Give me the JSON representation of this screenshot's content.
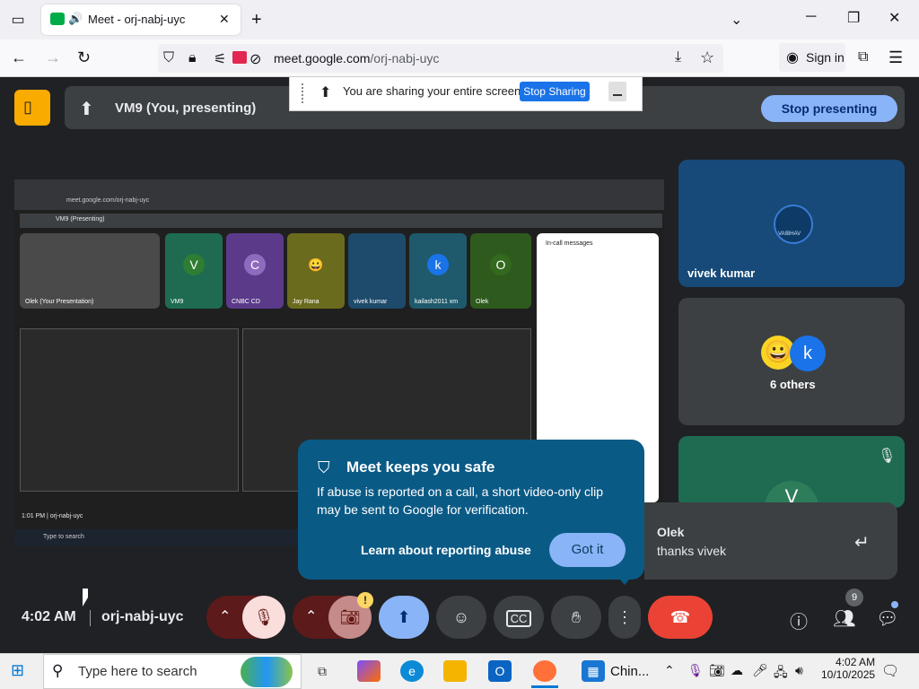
{
  "browser": {
    "tab_title": "Meet - orj-nabj-uyc",
    "url_host": "meet.google.com",
    "url_path": "/orj-nabj-uyc",
    "sign_in": "Sign in"
  },
  "share_banner": {
    "text": "You are sharing your entire screen.",
    "stop_label": "Stop Sharing"
  },
  "header": {
    "presenting_title": "VM9 (You, presenting)",
    "stop_presenting_label": "Stop presenting"
  },
  "shared_screen": {
    "url": "meet.google.com/orj-nabj-uyc",
    "meet_header": "VM9 (Presenting)",
    "tiles": [
      {
        "name": "Olek (Your Presentation)",
        "initial": ""
      },
      {
        "name": "VM9",
        "initial": "V"
      },
      {
        "name": "CNBC CD",
        "initial": "C"
      },
      {
        "name": "Jay Rana",
        "initial": "😀"
      },
      {
        "name": "vivek kumar",
        "initial": ""
      },
      {
        "name": "kailash2011 xm",
        "initial": "k"
      },
      {
        "name": "Olek",
        "initial": "O"
      }
    ],
    "chat_title": "In-call messages",
    "time_code": "1:01 PM | orj-nabj-uyc",
    "taskbar_search": "Type to search"
  },
  "participants": [
    {
      "name": "vivek kumar",
      "badge": "VAIBHAV"
    },
    {
      "name": "6 others",
      "initial": "k"
    },
    {
      "name": "",
      "initial": "V"
    }
  ],
  "safety_popup": {
    "title": "Meet keeps you safe",
    "body": "If abuse is reported on a call, a short video-only clip may be sent to Google for verification.",
    "learn_link": "Learn about reporting abuse",
    "got_it": "Got it"
  },
  "notification": {
    "sender": "Olek",
    "message": "thanks vivek"
  },
  "controls": {
    "time": "4:02 AM",
    "meeting_code": "orj-nabj-uyc",
    "people_count": "9"
  },
  "taskbar": {
    "search_placeholder": "Type here to search",
    "app_label": "Chin...",
    "time": "4:02 AM",
    "date": "10/10/2025"
  },
  "colors": {
    "meet_bg": "#202124",
    "accent_blue": "#8ab4f8",
    "end_call_red": "#ea4335",
    "popup_blue": "#0a5a86"
  }
}
